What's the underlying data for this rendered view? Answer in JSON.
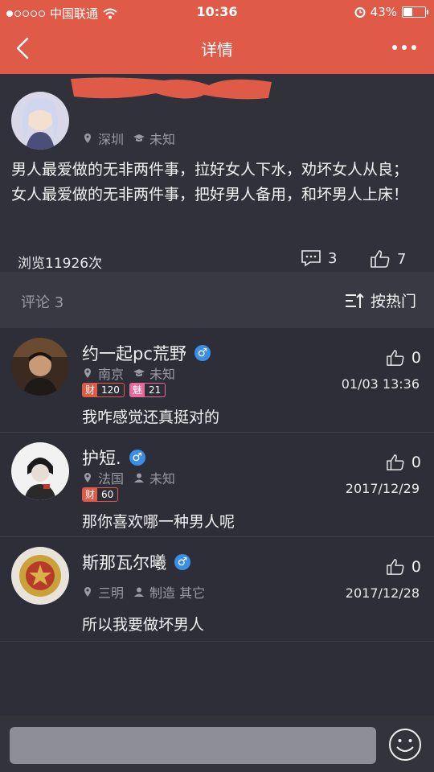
{
  "status_bar": {
    "carrier": "中国联通",
    "time": "10:36",
    "battery_percent": "43%",
    "battery_level": 0.43,
    "signal_bars_filled": 1
  },
  "nav": {
    "title": "详情"
  },
  "post": {
    "location": "深圳",
    "education": "未知",
    "text": "男人最爱做的无非两件事，拉好女人下水，劝坏女人从良；女人最爱做的无非两件事，把好男人备用，和坏男人上床！",
    "views": "浏览11926次",
    "comment_count": "3",
    "like_count": "7"
  },
  "comments_header": {
    "label": "评论 3",
    "sort_label": "按热门"
  },
  "comments": [
    {
      "name": "约一起pc荒野",
      "location": "南京",
      "tag": "未知",
      "tag_icon": "graduation-cap-icon",
      "badges": [
        {
          "key": "财",
          "value": "120"
        },
        {
          "key": "魅",
          "value": "21"
        }
      ],
      "text": "我咋感觉还真挺对的",
      "likes": "0",
      "time": "01/03 13:36"
    },
    {
      "name": "护短.",
      "location": "法国",
      "tag": "未知",
      "tag_icon": "person-icon",
      "badges": [
        {
          "key": "财",
          "value": "60"
        }
      ],
      "text": "那你喜欢哪一种男人呢",
      "likes": "0",
      "time": "2017/12/29"
    },
    {
      "name": "斯那瓦尔曦",
      "location": "三明",
      "tag": "制造 其它",
      "tag_icon": "person-icon",
      "badges": [],
      "text": "所以我要做坏男人",
      "likes": "0",
      "time": "2017/12/28"
    }
  ],
  "colors": {
    "accent": "#e05a48",
    "background": "#2e2e38",
    "male_badge": "#3a8ee6"
  }
}
